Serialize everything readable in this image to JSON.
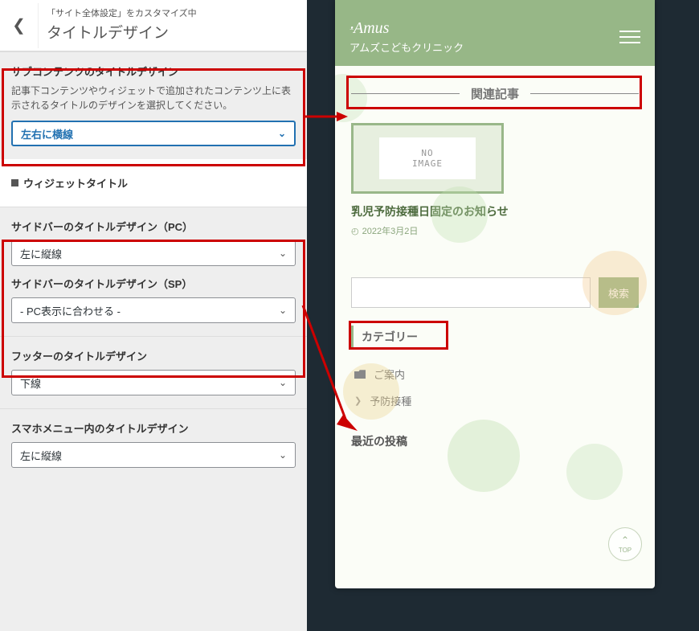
{
  "header": {
    "customizing": "「サイト全体設定」をカスタマイズ中",
    "title": "タイトルデザイン"
  },
  "sub_content": {
    "title": "サブコンテンツのタイトルデザイン",
    "desc": "記事下コンテンツやウィジェットで追加されたコンテンツ上に表示されるタイトルのデザインを選択してください。",
    "value": "左右に横線"
  },
  "widget_heading": "ウィジェットタイトル",
  "sidebar_pc": {
    "title": "サイドバーのタイトルデザイン（PC）",
    "value": "左に縦線"
  },
  "sidebar_sp": {
    "title": "サイドバーのタイトルデザイン（SP）",
    "value": "- PC表示に合わせる -"
  },
  "footer": {
    "title": "フッターのタイトルデザイン",
    "value": "下線"
  },
  "sp_menu": {
    "title": "スマホメニュー内のタイトルデザイン",
    "value": "左に縦線"
  },
  "preview": {
    "brand_script": "Amus",
    "brand_jp": "アムズこどもクリニック",
    "related_title": "関連記事",
    "no_image_1": "NO",
    "no_image_2": "IMAGE",
    "card_title": "乳児予防接種日固定のお知らせ",
    "card_date": "2022年3月2日",
    "search_btn": "検索",
    "category_title": "カテゴリー",
    "cat_1": "ご案内",
    "cat_2": "予防接種",
    "recent_title": "最近の投稿",
    "top_label": "TOP"
  }
}
